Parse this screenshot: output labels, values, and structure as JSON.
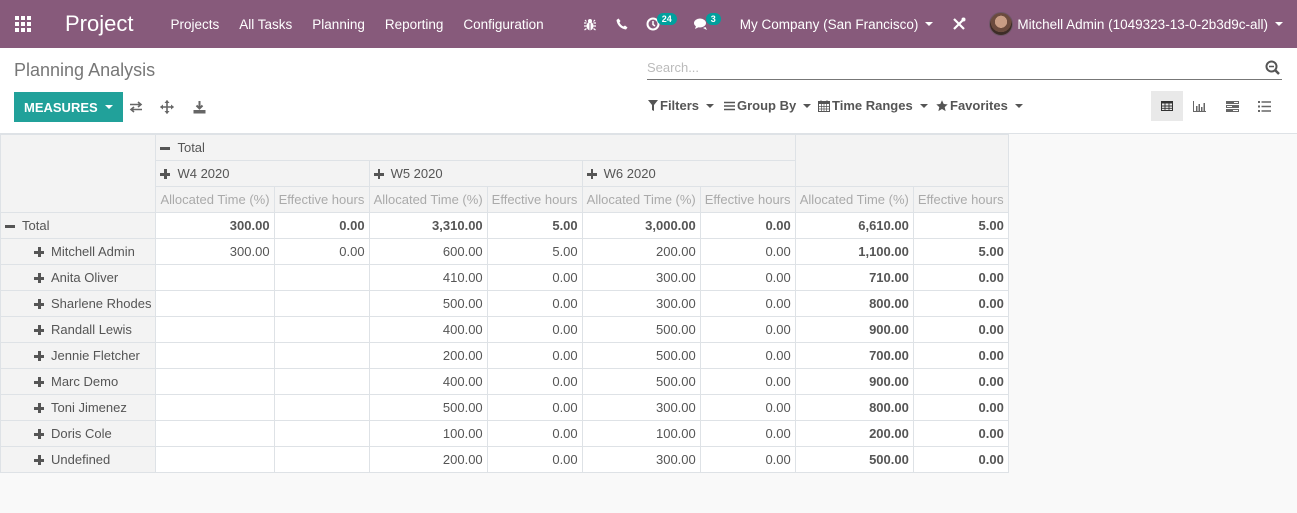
{
  "navbar": {
    "app_name": "Project",
    "menu": [
      "Projects",
      "All Tasks",
      "Planning",
      "Reporting",
      "Configuration"
    ],
    "activity_count": "24",
    "message_count": "3",
    "company": "My Company (San Francisco)",
    "user": "Mitchell Admin (1049323-13-0-2b3d9c-all)",
    "brand_color": "#875a7b",
    "badge_color": "#00a09d"
  },
  "control_panel": {
    "title": "Planning Analysis",
    "search_placeholder": "Search...",
    "measures_label": "MEASURES",
    "filters_label": "Filters",
    "groupby_label": "Group By",
    "timeranges_label": "Time Ranges",
    "favorites_label": "Favorites",
    "accent_color": "#21a19a",
    "views": [
      "pivot",
      "graph",
      "gantt",
      "list"
    ],
    "active_view": "pivot"
  },
  "pivot": {
    "col_root": "Total",
    "col_groups": [
      "W4 2020",
      "W5 2020",
      "W6 2020"
    ],
    "measures": [
      "Allocated Time (%)",
      "Effective hours"
    ],
    "row_root": "Total",
    "total_row": [
      "300.00",
      "0.00",
      "3,310.00",
      "5.00",
      "3,000.00",
      "0.00",
      "6,610.00",
      "5.00"
    ],
    "rows": [
      {
        "name": "Mitchell Admin",
        "values": [
          "300.00",
          "0.00",
          "600.00",
          "5.00",
          "200.00",
          "0.00",
          "1,100.00",
          "5.00"
        ]
      },
      {
        "name": "Anita Oliver",
        "values": [
          "",
          "",
          "410.00",
          "0.00",
          "300.00",
          "0.00",
          "710.00",
          "0.00"
        ]
      },
      {
        "name": "Sharlene Rhodes",
        "values": [
          "",
          "",
          "500.00",
          "0.00",
          "300.00",
          "0.00",
          "800.00",
          "0.00"
        ]
      },
      {
        "name": "Randall Lewis",
        "values": [
          "",
          "",
          "400.00",
          "0.00",
          "500.00",
          "0.00",
          "900.00",
          "0.00"
        ]
      },
      {
        "name": "Jennie Fletcher",
        "values": [
          "",
          "",
          "200.00",
          "0.00",
          "500.00",
          "0.00",
          "700.00",
          "0.00"
        ]
      },
      {
        "name": "Marc Demo",
        "values": [
          "",
          "",
          "400.00",
          "0.00",
          "500.00",
          "0.00",
          "900.00",
          "0.00"
        ]
      },
      {
        "name": "Toni Jimenez",
        "values": [
          "",
          "",
          "500.00",
          "0.00",
          "300.00",
          "0.00",
          "800.00",
          "0.00"
        ]
      },
      {
        "name": "Doris Cole",
        "values": [
          "",
          "",
          "100.00",
          "0.00",
          "100.00",
          "0.00",
          "200.00",
          "0.00"
        ]
      },
      {
        "name": "Undefined",
        "values": [
          "",
          "",
          "200.00",
          "0.00",
          "300.00",
          "0.00",
          "500.00",
          "0.00"
        ]
      }
    ]
  }
}
